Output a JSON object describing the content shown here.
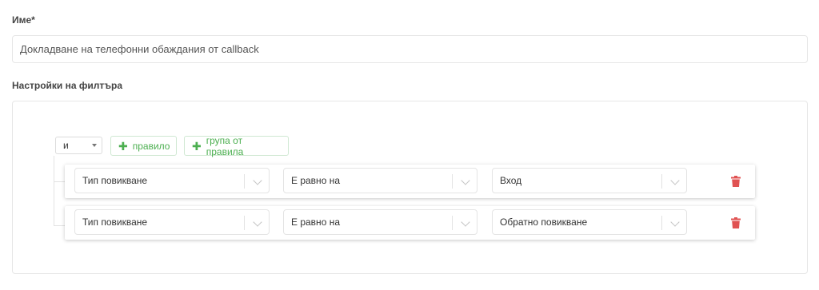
{
  "form": {
    "name_label": "Име*",
    "name_value": "Докладване на телефонни обаждания от callback",
    "filter_label": "Настройки на филтъра"
  },
  "filter": {
    "condition": "и",
    "add_rule_label": "правило",
    "add_group_label": "група от правила",
    "rules": [
      {
        "field": "Тип повикване",
        "operator": "Е равно на",
        "value": "Вход"
      },
      {
        "field": "Тип повикване",
        "operator": "Е равно на",
        "value": "Обратно повикване"
      }
    ]
  },
  "colors": {
    "accent_green": "#4caf50",
    "delete_red": "#e05252"
  }
}
